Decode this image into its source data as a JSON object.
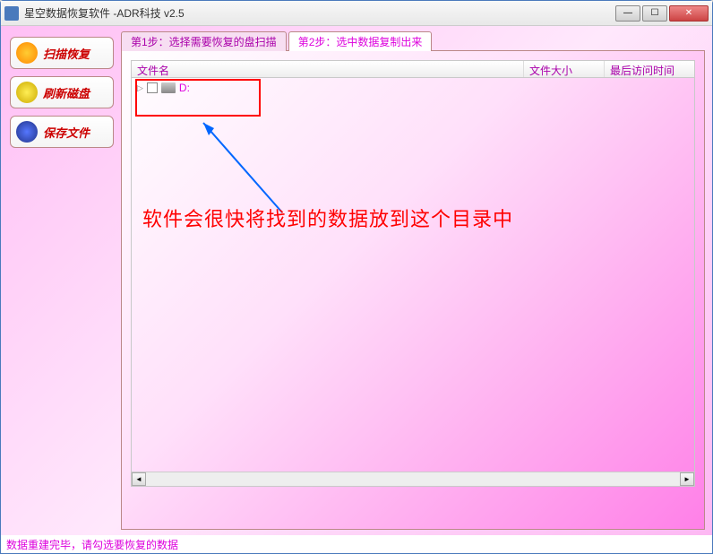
{
  "window": {
    "title": "星空数据恢复软件   -ADR科技 v2.5"
  },
  "sidebar": {
    "scan": "扫描恢复",
    "refresh": "刷新磁盘",
    "save": "保存文件"
  },
  "tabs": {
    "step1": "第1步：选择需要恢复的盘扫描",
    "step2": "第2步：选中数据复制出来"
  },
  "columns": {
    "name": "文件名",
    "size": "文件大小",
    "time": "最后访问时间"
  },
  "tree": {
    "drive": "D:"
  },
  "annotation": "软件会很快将找到的数据放到这个目录中",
  "status": "数据重建完毕，请勾选要恢复的数据"
}
